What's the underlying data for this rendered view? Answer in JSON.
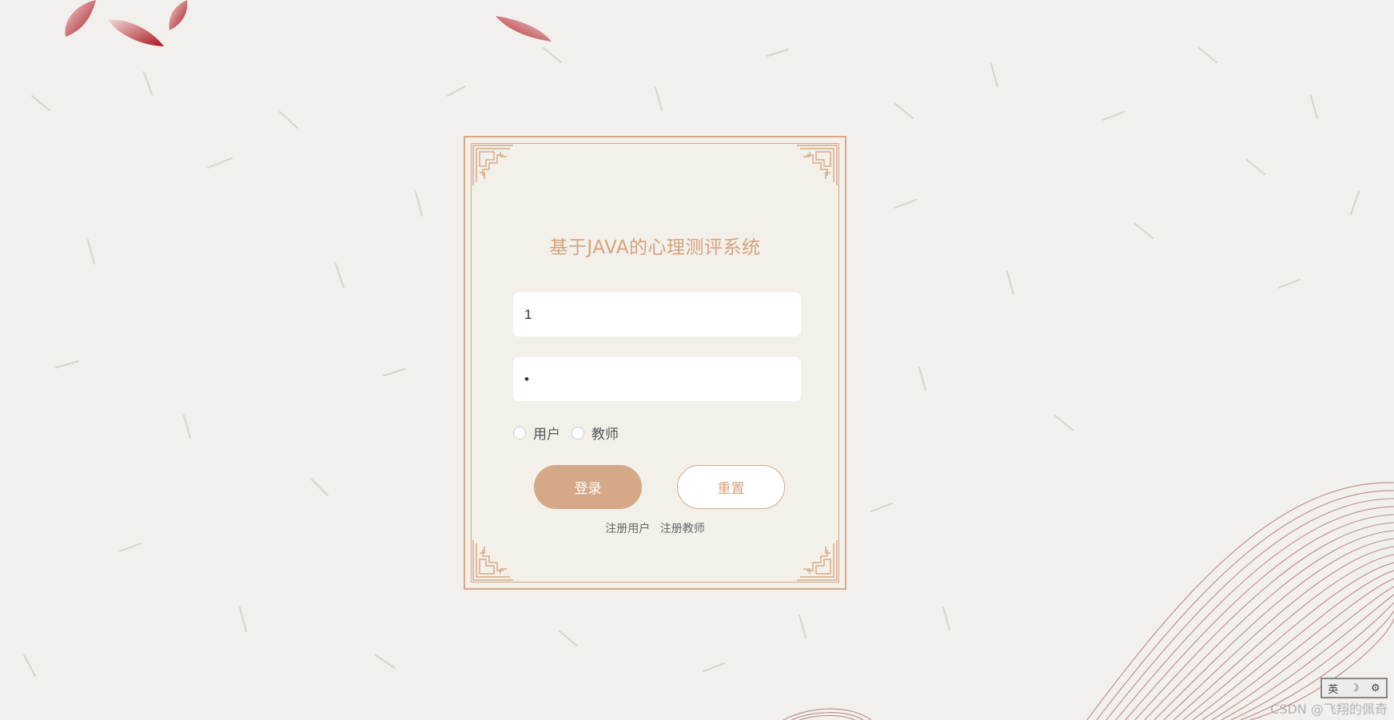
{
  "login": {
    "title": "基于JAVA的心理测评系统",
    "username_value": "1",
    "password_value": "•",
    "roles": [
      "用户",
      "教师"
    ],
    "login_button": "登录",
    "reset_button": "重置",
    "register_links": [
      "注册用户",
      "注册教师"
    ]
  },
  "ime": {
    "mode": "英",
    "moon": "☽",
    "settings": "⚙"
  },
  "watermark": "CSDN @飞翔的佩奇",
  "colors": {
    "accent": "#d5a987",
    "title": "#d5a27d",
    "background": "#f2f0ec",
    "petal": "#b22222",
    "wave": "#b07a7a"
  },
  "icons": [
    "petal-decoration",
    "wave-decoration",
    "lattice-corner-icon",
    "radio-icon"
  ]
}
